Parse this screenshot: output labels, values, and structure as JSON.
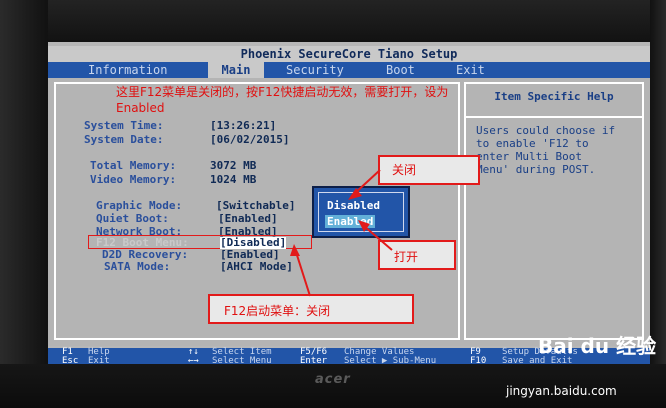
{
  "bios": {
    "title": "Phoenix SecureCore Tiano Setup",
    "tabs": [
      {
        "label": "Information"
      },
      {
        "label": "Main",
        "active": true
      },
      {
        "label": "Security"
      },
      {
        "label": "Boot"
      },
      {
        "label": "Exit"
      }
    ],
    "main": {
      "system_time": {
        "label": "System Time:",
        "value": "[13:26:21]"
      },
      "system_date": {
        "label": "System Date:",
        "value": "[06/02/2015]"
      },
      "total_memory": {
        "label": "Total Memory:",
        "value": "3072 MB"
      },
      "video_memory": {
        "label": "Video Memory:",
        "value": "1024 MB"
      },
      "graphic_mode": {
        "label": "Graphic Mode:",
        "value": "[Switchable]"
      },
      "quiet_boot": {
        "label": "Quiet Boot:",
        "value": "[Enabled]"
      },
      "network_boot": {
        "label": "Network Boot:",
        "value": "[Enabled]"
      },
      "f12_boot_menu": {
        "label": "F12 Boot Menu:",
        "value": "[Disabled]"
      },
      "d2d_recovery": {
        "label": "D2D Recovery:",
        "value": "[Enabled]"
      },
      "sata_mode": {
        "label": "SATA Mode:",
        "value": "[AHCI Mode]"
      }
    },
    "popup": {
      "options": [
        "Disabled",
        "Enabled"
      ],
      "selected": "Enabled"
    },
    "help": {
      "title": "Item Specific Help",
      "text": "Users could choose if\nto enable 'F12 to\nenter Multi Boot\nMenu' during POST."
    },
    "footer": {
      "row1": [
        {
          "key": "F1",
          "desc": "Help"
        },
        {
          "key": "↑↓",
          "desc": "Select Item"
        },
        {
          "key": "F5/F6",
          "desc": "Change Values"
        },
        {
          "key": "F9",
          "desc": "Setup Defaults"
        }
      ],
      "row2": [
        {
          "key": "Esc",
          "desc": "Exit"
        },
        {
          "key": "←→",
          "desc": "Select Menu"
        },
        {
          "key": "Enter",
          "desc": "Select ▶ Sub-Menu"
        },
        {
          "key": "F10",
          "desc": "Save and Exit"
        }
      ]
    }
  },
  "annotations": {
    "top_note": "这里F12菜单是关闭的，按F12快捷启动无效，需要打开，设为Enabled",
    "label_close": "关闭",
    "label_open": "打开",
    "bottom_note": "F12启动菜单：关闭"
  },
  "device": {
    "brand": "acer"
  },
  "watermark": {
    "text": "Bai du 经验",
    "url": "jingyan.baidu.com"
  },
  "colors": {
    "bios_blue": "#2255a8",
    "bios_gray": "#b4b4b4",
    "annotation_red": "#e21a1a"
  }
}
